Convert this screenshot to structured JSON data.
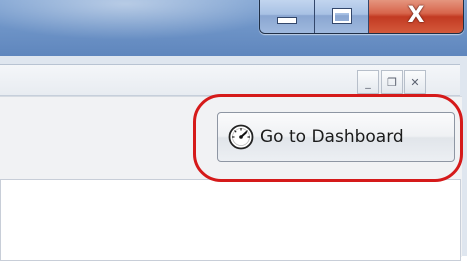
{
  "window": {
    "caption_buttons": {
      "minimize_icon": "minimize-icon",
      "maximize_icon": "maximize-icon",
      "close_icon": "close-icon",
      "close_glyph": "X"
    }
  },
  "mdi_controls": {
    "minimize_glyph": "_",
    "restore_glyph": "❐",
    "close_glyph": "✕"
  },
  "toolbar": {
    "dashboard_button": {
      "label": "Go to Dashboard",
      "icon": "speedometer-icon"
    }
  },
  "colors": {
    "highlight_ring": "#d51a1a",
    "titlebar": "#6f95c8",
    "close_button": "#c23a22"
  }
}
